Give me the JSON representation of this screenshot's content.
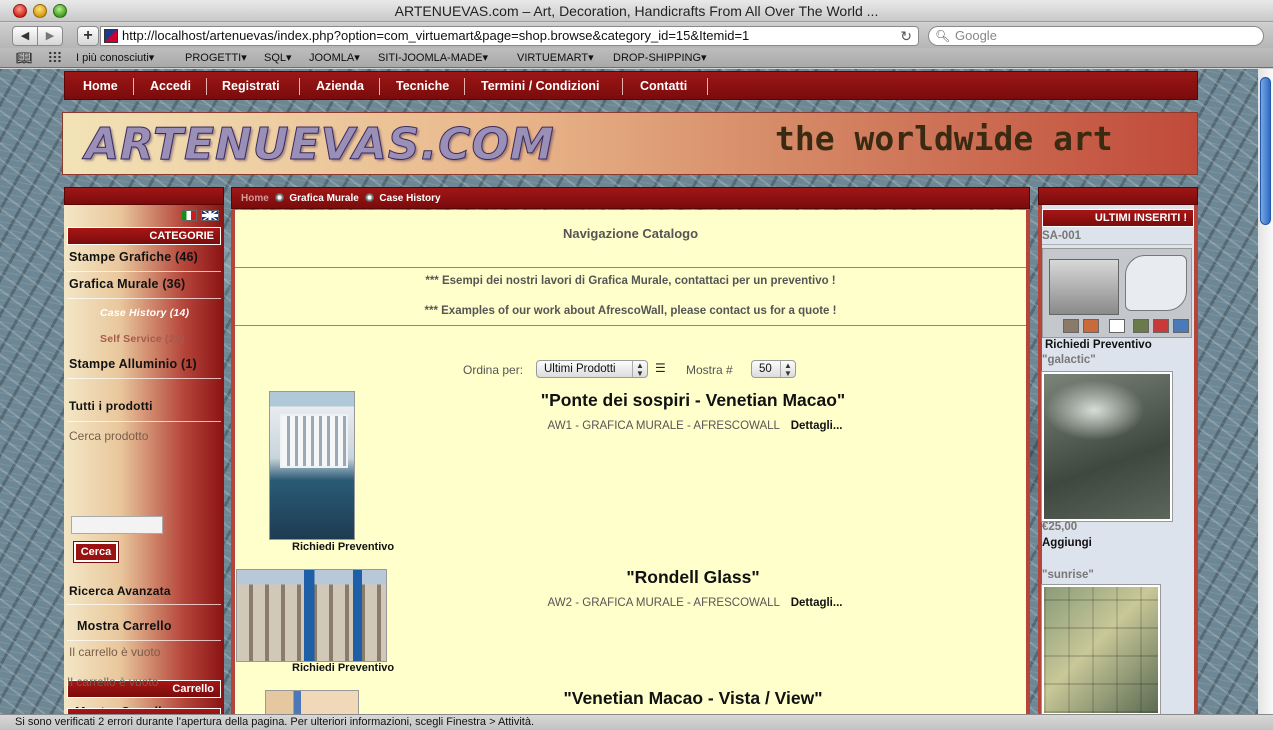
{
  "window": {
    "title": "ARTENUEVAS.com – Art, Decoration, Handicrafts From All Over The World ..."
  },
  "toolbar": {
    "back": "◀",
    "forward": "▶",
    "add": "+",
    "url": "http://localhost/artenuevas/index.php?option=com_virtuemart&page=shop.browse&category_id=15&Itemid=1",
    "search_placeholder": "Google"
  },
  "bookmarks": [
    "I più conosciuti▾",
    "PROGETTI▾",
    "SQL▾",
    "JOOMLA▾",
    "SITI-JOOMLA-MADE▾",
    "VIRTUEMART▾",
    "DROP-SHIPPING▾"
  ],
  "nav": [
    "Home",
    "Accedi",
    "Registrati",
    "Azienda",
    "Tecniche",
    "Termini / Condizioni",
    "Contatti"
  ],
  "banner": {
    "logo": "ARTENUEVAS.COM",
    "slogan": "the worldwide art"
  },
  "breadcrumb": {
    "home": "Home",
    "level1": "Grafica Murale",
    "level2": "Case History"
  },
  "left": {
    "categorie_title": "CATEGORIE",
    "categories": [
      {
        "label": "Stampe Grafiche (46)"
      },
      {
        "label": "Grafica Murale (36)"
      },
      {
        "label": "Case History (14)"
      },
      {
        "label": "Self Service (22)"
      },
      {
        "label": "Stampe Alluminio (1)"
      }
    ],
    "tutti": "Tutti i prodotti",
    "cerca_label": "Cerca prodotto",
    "cerca_button": "Cerca",
    "ricerca_avanzata": "Ricerca Avanzata",
    "mostra_carrello": "Mostra Carrello",
    "carrello_vuoto": "Il carrello è vuoto",
    "carrello_title": "Carrello",
    "mostra_carrello2": "Mostra Carrello",
    "carrello_vuoto2": "Il carrello è vuoto"
  },
  "main": {
    "title": "Navigazione Catalogo",
    "notice_it": "*** Esempi dei nostri lavori di Grafica Murale, contattaci per un preventivo !",
    "notice_en": "*** Examples of our work about AfrescoWall, please contact us for a quote !",
    "ordina_label": "Ordina per:",
    "ordina_value": "Ultimi Prodotti",
    "mostra_label": "Mostra #",
    "mostra_value": "50",
    "products": [
      {
        "title": "\"Ponte dei sospiri - Venetian Macao\"",
        "meta": "AW1 - GRAFICA MURALE - AFRESCOWALL",
        "details": "Dettagli...",
        "cta": "Richiedi Preventivo"
      },
      {
        "title": "\"Rondell Glass\"",
        "meta": "AW2 - GRAFICA MURALE - AFRESCOWALL",
        "details": "Dettagli...",
        "cta": "Richiedi Preventivo"
      },
      {
        "title": "\"Venetian Macao - Vista / View\""
      }
    ]
  },
  "right": {
    "title": "ULTIMI INSERITI !",
    "item1_code": "SA-001",
    "item1_cta": "Richiedi Preventivo",
    "item2_name": "\"galactic\"",
    "item2_price": "€25,00",
    "item2_cta": "Aggiungi",
    "item3_name": "\"sunrise\""
  },
  "status": "Si sono verificati 2 errori durante l'apertura della pagina. Per ulteriori informazioni, scegli Finestra > Attività."
}
